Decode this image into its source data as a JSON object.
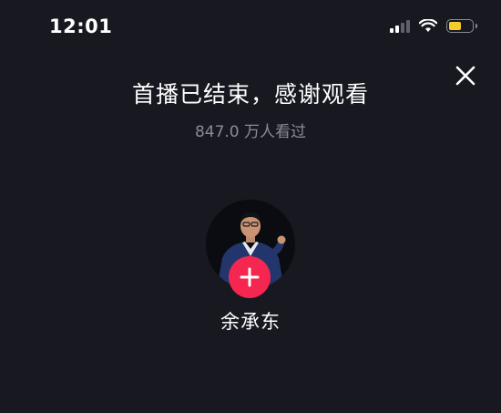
{
  "status_bar": {
    "time": "12:01",
    "signal_icon": "cellular-signal-icon",
    "wifi_icon": "wifi-icon",
    "battery_icon": "battery-icon",
    "battery_color": "#f5cc2b"
  },
  "header": {
    "close_icon": "close-icon"
  },
  "live_end": {
    "title": "首播已结束，感谢观看",
    "viewers": "847.0 万人看过"
  },
  "host": {
    "name": "余承东",
    "follow_icon": "plus-icon",
    "follow_color": "#f5264f"
  }
}
